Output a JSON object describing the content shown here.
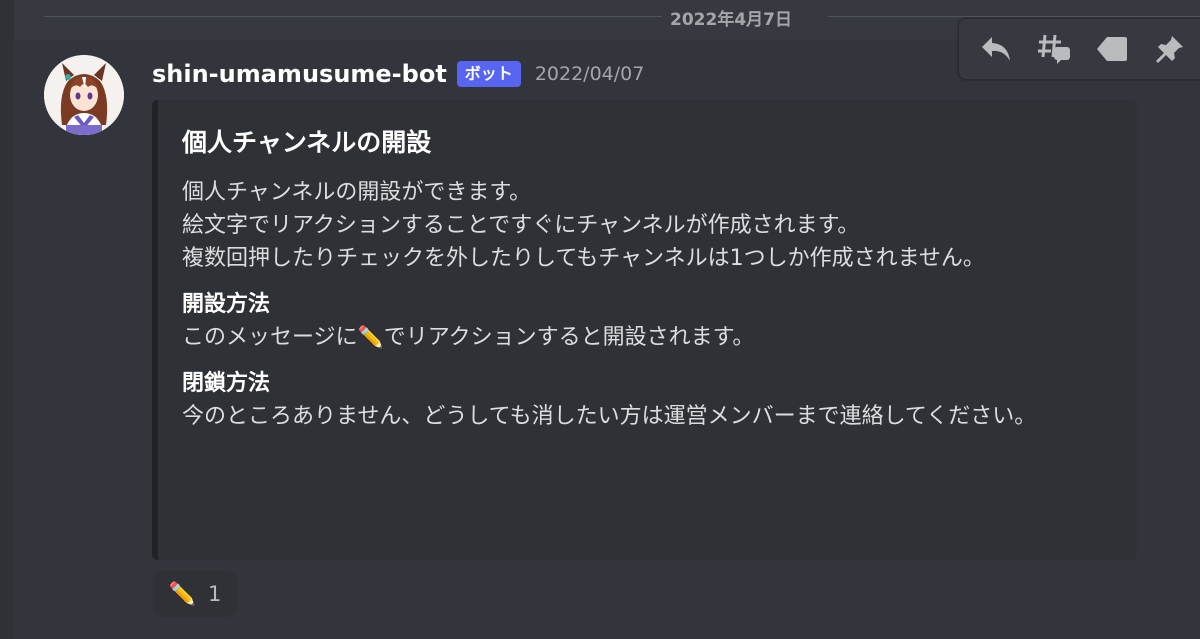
{
  "date_divider": "2022年4月7日",
  "message": {
    "username": "shin-umamusume-bot",
    "bot_tag": "ボット",
    "timestamp": "2022/04/07"
  },
  "embed": {
    "title": "個人チャンネルの開設",
    "description": [
      "個人チャンネルの開設ができます。",
      "絵文字でリアクションすることですぐにチャンネルが作成されます。",
      "複数回押したりチェックを外したりしてもチャンネルは1つしか作成されません。"
    ],
    "fields": [
      {
        "name": "開設方法",
        "value_before": "このメッセージに",
        "value_emoji": "✏️",
        "value_after": "でリアクションすると開設されます。"
      },
      {
        "name": "閉鎖方法",
        "value": "今のところありません、どうしても消したい方は運営メンバーまで連絡してください。"
      }
    ]
  },
  "reaction": {
    "emoji": "✏️",
    "count": "1"
  },
  "toolbar": {
    "icons": [
      "reply-icon",
      "create-thread-icon",
      "tag-icon",
      "pin-icon"
    ]
  },
  "colors": {
    "background": "#36393f",
    "embed_background": "#2f3136",
    "bot_tag": "#5865f2",
    "muted_text": "#a3a6aa"
  }
}
